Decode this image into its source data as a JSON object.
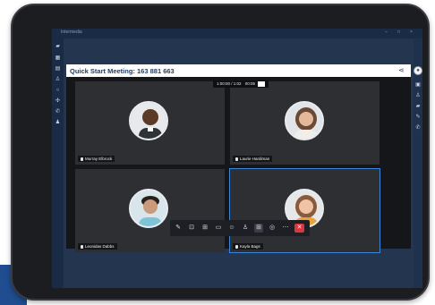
{
  "window": {
    "app_title": "Intermedia",
    "controls": [
      "–",
      "□",
      "×"
    ]
  },
  "meeting": {
    "title": "Quick Start Meeting: 163 881 663",
    "status_text": "1:00:00 / 1:02",
    "status_text2": "00:05"
  },
  "participants": [
    {
      "name": "Murray Elbrock",
      "tile": "top-left"
    },
    {
      "name": "Laurie Hardiman",
      "tile": "top-right"
    },
    {
      "name": "Leonidas Dabbs",
      "tile": "bottom-left"
    },
    {
      "name": "Kayla Bags",
      "tile": "bottom-right",
      "active": true
    }
  ],
  "left_rail_icons": [
    "chat-icon",
    "calendar-icon",
    "voicemail-icon",
    "contacts-icon",
    "meetings-icon",
    "apps-icon",
    "phone-icon",
    "user-icon"
  ],
  "right_rail_icons": [
    "panel-icon",
    "participants-icon",
    "chat-icon",
    "pen-icon",
    "phone-icon"
  ],
  "toolbar_icons": [
    "mic-icon",
    "camera-icon",
    "share-screen-icon",
    "chat-icon",
    "reactions-icon",
    "participants-icon",
    "layout-icon",
    "more-icon",
    "record-icon",
    "end-call-icon"
  ],
  "colors": {
    "screen_bg": "#24364f",
    "header_title": "#1e3e6b",
    "active_border": "#3c86d8",
    "end_call": "#d9363e"
  }
}
